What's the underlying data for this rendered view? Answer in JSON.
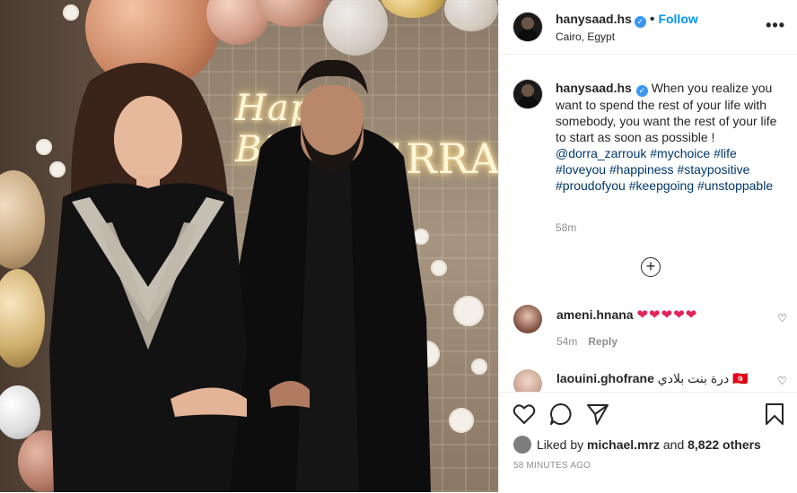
{
  "header": {
    "username": "hanysaad.hs",
    "separator": "•",
    "follow_label": "Follow",
    "location": "Cairo, Egypt",
    "more_icon": "more-options-icon"
  },
  "photo": {
    "neon_line1": "Happy Birthday",
    "neon_line2": "RRA"
  },
  "caption": {
    "username": "hanysaad.hs",
    "text": "When you realize you want to spend the rest of your life with somebody, you want the rest of your life to start as soon as possible !",
    "mention": "@dorra_zarrouk",
    "hashtags": [
      "#mychoice",
      "#life",
      "#loveyou",
      "#happiness",
      "#staypositive",
      "#proudofyou",
      "#keepgoing",
      "#unstoppable"
    ],
    "time": "58m"
  },
  "load_more_icon": "plus-circle-icon",
  "comments": [
    {
      "username": "ameni.hnana",
      "text": "❤❤❤❤❤",
      "time": "54m",
      "reply_label": "Reply"
    },
    {
      "username": "laouini.ghofrane",
      "text": "درة بنت بلادي 🇹🇳"
    }
  ],
  "actions": {
    "liked_by_prefix": "Liked by",
    "liked_by_user": "michael.mrz",
    "and_label": "and",
    "others": "8,822 others",
    "posted_ago": "58 MINUTES AGO"
  },
  "colors": {
    "link_blue": "#0095f6",
    "hashtag": "#00376b",
    "heart_red": "#e0245e",
    "muted": "#8e8e8e"
  }
}
